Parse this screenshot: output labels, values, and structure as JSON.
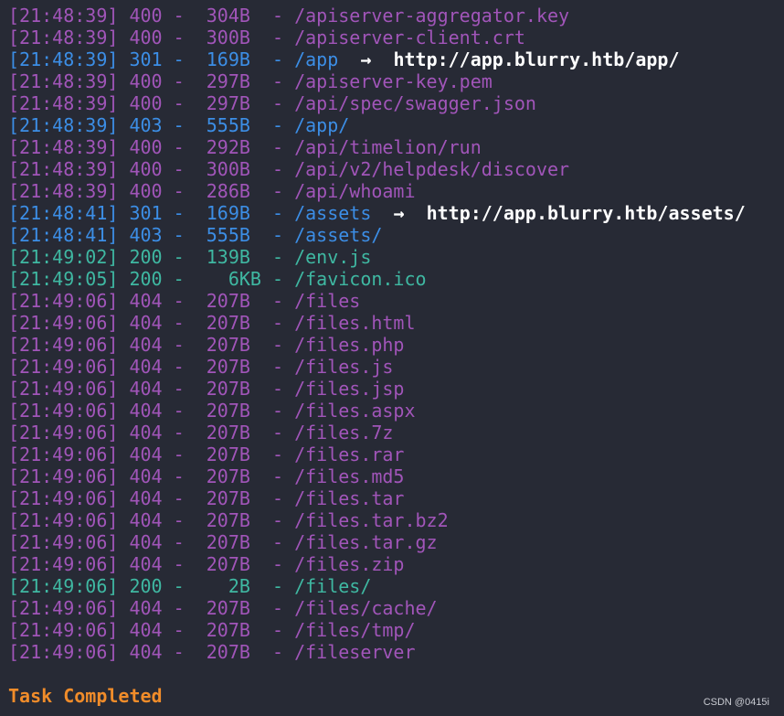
{
  "colors": {
    "background": "#272a35",
    "status_4xx": "#a155b9",
    "status_3xx": "#3c8ee6",
    "status_2xx": "#3fb8a2",
    "redirect_text": "#ffffff",
    "task_completed": "#f08c2a"
  },
  "lines": [
    {
      "text": "[21:48:39] 400 -  304B  - /apiserver-aggregator.key",
      "kind": "s4xx",
      "redirect": ""
    },
    {
      "text": "[21:48:39] 400 -  300B  - /apiserver-client.crt",
      "kind": "s4xx",
      "redirect": ""
    },
    {
      "text": "[21:48:39] 301 -  169B  - /app",
      "kind": "s3xx",
      "redirect": "  →  http://app.blurry.htb/app/"
    },
    {
      "text": "[21:48:39] 400 -  297B  - /apiserver-key.pem",
      "kind": "s4xx",
      "redirect": ""
    },
    {
      "text": "[21:48:39] 400 -  297B  - /api/spec/swagger.json",
      "kind": "s4xx",
      "redirect": ""
    },
    {
      "text": "[21:48:39] 403 -  555B  - /app/",
      "kind": "s3xx",
      "redirect": ""
    },
    {
      "text": "[21:48:39] 400 -  292B  - /api/timelion/run",
      "kind": "s4xx",
      "redirect": ""
    },
    {
      "text": "[21:48:39] 400 -  300B  - /api/v2/helpdesk/discover",
      "kind": "s4xx",
      "redirect": ""
    },
    {
      "text": "[21:48:39] 400 -  286B  - /api/whoami",
      "kind": "s4xx",
      "redirect": ""
    },
    {
      "text": "[21:48:41] 301 -  169B  - /assets",
      "kind": "s3xx",
      "redirect": "  →  http://app.blurry.htb/assets/"
    },
    {
      "text": "[21:48:41] 403 -  555B  - /assets/",
      "kind": "s3xx",
      "redirect": ""
    },
    {
      "text": "[21:49:02] 200 -  139B  - /env.js",
      "kind": "s2xx",
      "redirect": ""
    },
    {
      "text": "[21:49:05] 200 -    6KB - /favicon.ico",
      "kind": "s2xx",
      "redirect": ""
    },
    {
      "text": "[21:49:06] 404 -  207B  - /files",
      "kind": "s4xx",
      "redirect": ""
    },
    {
      "text": "[21:49:06] 404 -  207B  - /files.html",
      "kind": "s4xx",
      "redirect": ""
    },
    {
      "text": "[21:49:06] 404 -  207B  - /files.php",
      "kind": "s4xx",
      "redirect": ""
    },
    {
      "text": "[21:49:06] 404 -  207B  - /files.js",
      "kind": "s4xx",
      "redirect": ""
    },
    {
      "text": "[21:49:06] 404 -  207B  - /files.jsp",
      "kind": "s4xx",
      "redirect": ""
    },
    {
      "text": "[21:49:06] 404 -  207B  - /files.aspx",
      "kind": "s4xx",
      "redirect": ""
    },
    {
      "text": "[21:49:06] 404 -  207B  - /files.7z",
      "kind": "s4xx",
      "redirect": ""
    },
    {
      "text": "[21:49:06] 404 -  207B  - /files.rar",
      "kind": "s4xx",
      "redirect": ""
    },
    {
      "text": "[21:49:06] 404 -  207B  - /files.md5",
      "kind": "s4xx",
      "redirect": ""
    },
    {
      "text": "[21:49:06] 404 -  207B  - /files.tar",
      "kind": "s4xx",
      "redirect": ""
    },
    {
      "text": "[21:49:06] 404 -  207B  - /files.tar.bz2",
      "kind": "s4xx",
      "redirect": ""
    },
    {
      "text": "[21:49:06] 404 -  207B  - /files.tar.gz",
      "kind": "s4xx",
      "redirect": ""
    },
    {
      "text": "[21:49:06] 404 -  207B  - /files.zip",
      "kind": "s4xx",
      "redirect": ""
    },
    {
      "text": "[21:49:06] 200 -    2B  - /files/",
      "kind": "s2xx",
      "redirect": ""
    },
    {
      "text": "[21:49:06] 404 -  207B  - /files/cache/",
      "kind": "s4xx",
      "redirect": ""
    },
    {
      "text": "[21:49:06] 404 -  207B  - /files/tmp/",
      "kind": "s4xx",
      "redirect": ""
    },
    {
      "text": "[21:49:06] 404 -  207B  - /fileserver",
      "kind": "s4xx",
      "redirect": ""
    }
  ],
  "status": "Task Completed",
  "watermark": "CSDN @0415i"
}
